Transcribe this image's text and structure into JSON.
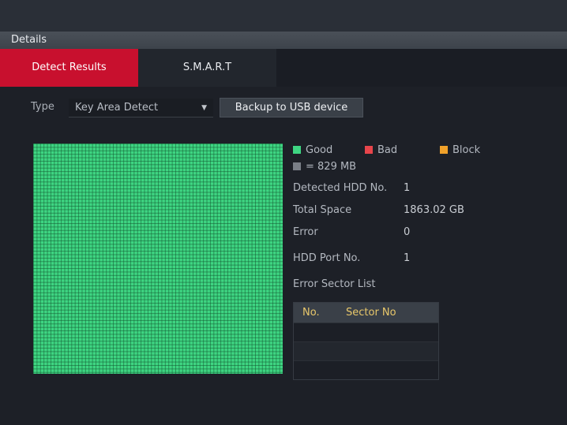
{
  "panel": {
    "title": "Details"
  },
  "tabs": [
    {
      "label": "Detect Results",
      "active": true
    },
    {
      "label": "S.M.A.R.T",
      "active": false
    }
  ],
  "type_filter": {
    "label": "Type",
    "value": "Key Area Detect"
  },
  "backup_button": {
    "label": "Backup to USB device"
  },
  "legend": {
    "good": {
      "label": "Good",
      "color": "#3ed582"
    },
    "bad": {
      "label": "Bad",
      "color": "#e8454b"
    },
    "block": {
      "label": "Block",
      "color": "#f0a12a"
    },
    "unit": {
      "label": "= 829 MB",
      "color": "#7a7f87"
    }
  },
  "info": {
    "detected_hdd_no": {
      "label": "Detected HDD No.",
      "value": "1"
    },
    "total_space": {
      "label": "Total Space",
      "value": "1863.02 GB"
    },
    "error": {
      "label": "Error",
      "value": "0"
    },
    "hdd_port_no": {
      "label": "HDD Port No.",
      "value": "1"
    }
  },
  "error_sector_list": {
    "title": "Error Sector List",
    "columns": [
      "No.",
      "Sector No"
    ],
    "rows": []
  },
  "colors": {
    "accent": "#c8102e",
    "header_text": "#e8c76a"
  }
}
